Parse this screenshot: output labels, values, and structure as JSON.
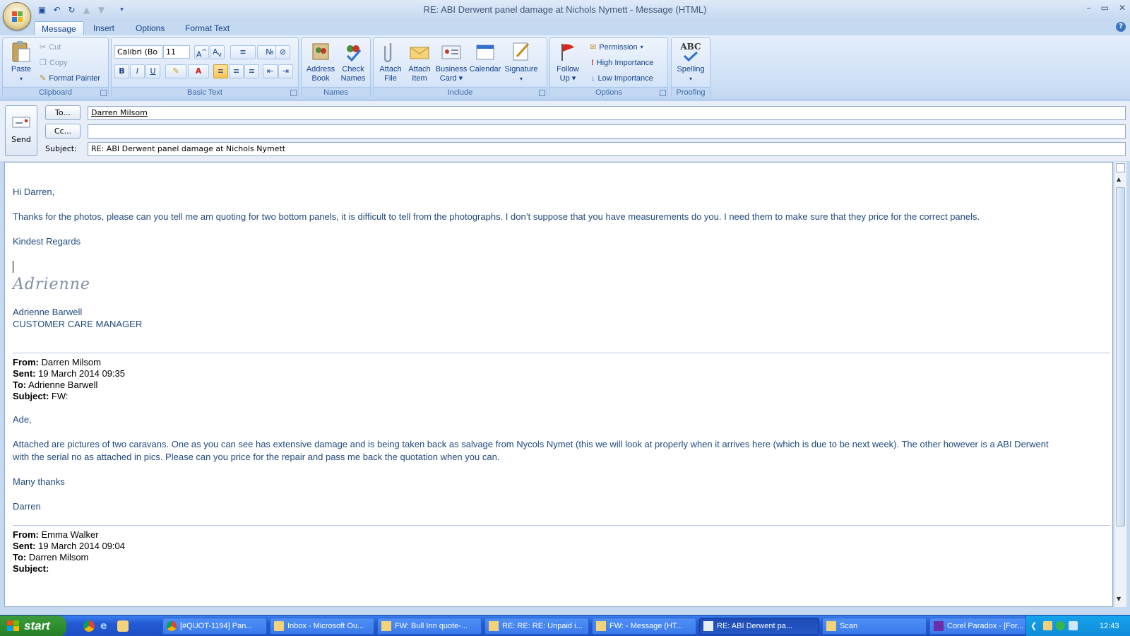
{
  "window": {
    "title": "RE: ABI Derwent panel damage at Nichols Nymett - Message (HTML)",
    "controls": [
      "–",
      "▭",
      "✕"
    ]
  },
  "tabs": [
    "Message",
    "Insert",
    "Options",
    "Format Text"
  ],
  "ribbon": {
    "clipboard": {
      "label": "Clipboard",
      "paste": "Paste",
      "cut": "Cut",
      "copy": "Copy",
      "format_painter": "Format Painter"
    },
    "basic_text": {
      "label": "Basic Text",
      "font": "Calibri (Bo",
      "size": "11",
      "bold": "B",
      "italic": "I",
      "underline": "U",
      "font_color": "A"
    },
    "names": {
      "label": "Names",
      "address_book": [
        "Address",
        "Book"
      ],
      "check_names": [
        "Check",
        "Names"
      ]
    },
    "include": {
      "label": "Include",
      "attach_file": [
        "Attach",
        "File"
      ],
      "attach_item": [
        "Attach",
        "Item"
      ],
      "business_card": [
        "Business",
        "Card"
      ],
      "calendar": "Calendar",
      "signature": "Signature"
    },
    "options": {
      "label": "Options",
      "follow_up": [
        "Follow",
        "Up"
      ],
      "permission": "Permission",
      "high_importance": "High Importance",
      "low_importance": "Low Importance"
    },
    "proofing": {
      "label": "Proofing",
      "spelling": "Spelling",
      "abc": "ABC"
    }
  },
  "header": {
    "send": "Send",
    "to_button": "To...",
    "cc_button": "Cc...",
    "subject_label": "Subject:",
    "to_value": "Darren Milsom",
    "cc_value": "",
    "subject_value": "RE: ABI Derwent panel damage at Nichols Nymett"
  },
  "message": {
    "greeting": "Hi Darren,",
    "para1": "Thanks for the photos, please can you tell me am quoting for two bottom panels, it is difficult to tell from the photographs.  I don’t suppose that you have measurements do you.  I need them to make sure that they price for the correct panels.",
    "regards": "Kindest Regards",
    "signature_script": "Adrienne",
    "sender_name": "Adrienne Barwell",
    "sender_title": "CUSTOMER CARE MANAGER",
    "quoted1": {
      "from_label": "From:",
      "from": "Darren Milsom",
      "sent_label": "Sent:",
      "sent": "19 March 2014 09:35",
      "to_label": "To:",
      "to": "Adrienne Barwell",
      "subject_label": "Subject:",
      "subject": "FW:",
      "greeting": "Ade,",
      "body_line1": "Attached are pictures of two caravans. One as you can see has extensive damage and is being taken back as salvage from Nycols Nymet (this we will look at properly when it arrives here (which is due to be next week). The other however is a ABI Derwent",
      "body_line2": "with the serial no as attached in pics. Please can you price for the repair and pass me back the quotation when you can.",
      "thanks": "Many thanks",
      "signoff": "Darren"
    },
    "quoted2": {
      "from_label": "From:",
      "from": "Emma Walker",
      "sent_label": "Sent:",
      "sent": "19 March 2014 09:04",
      "to_label": "To:",
      "to": "Darren Milsom",
      "subject_label": "Subject:",
      "subject": ""
    }
  },
  "taskbar": {
    "start": "start",
    "buttons": [
      "[#QUOT-1194] Pan...",
      "Inbox - Microsoft Ou...",
      "FW: Bull Inn  quote-...",
      "RE: RE: RE: Unpaid i...",
      "FW:  - Message (HT...",
      "RE: ABI Derwent pa...",
      "Scan",
      "Corel Paradox - [For..."
    ],
    "clock": "12:43"
  },
  "colors": {
    "accent": "#15428b",
    "body_text": "#1f497d",
    "taskbar": "#245edb",
    "start": "#2f8f2f"
  }
}
